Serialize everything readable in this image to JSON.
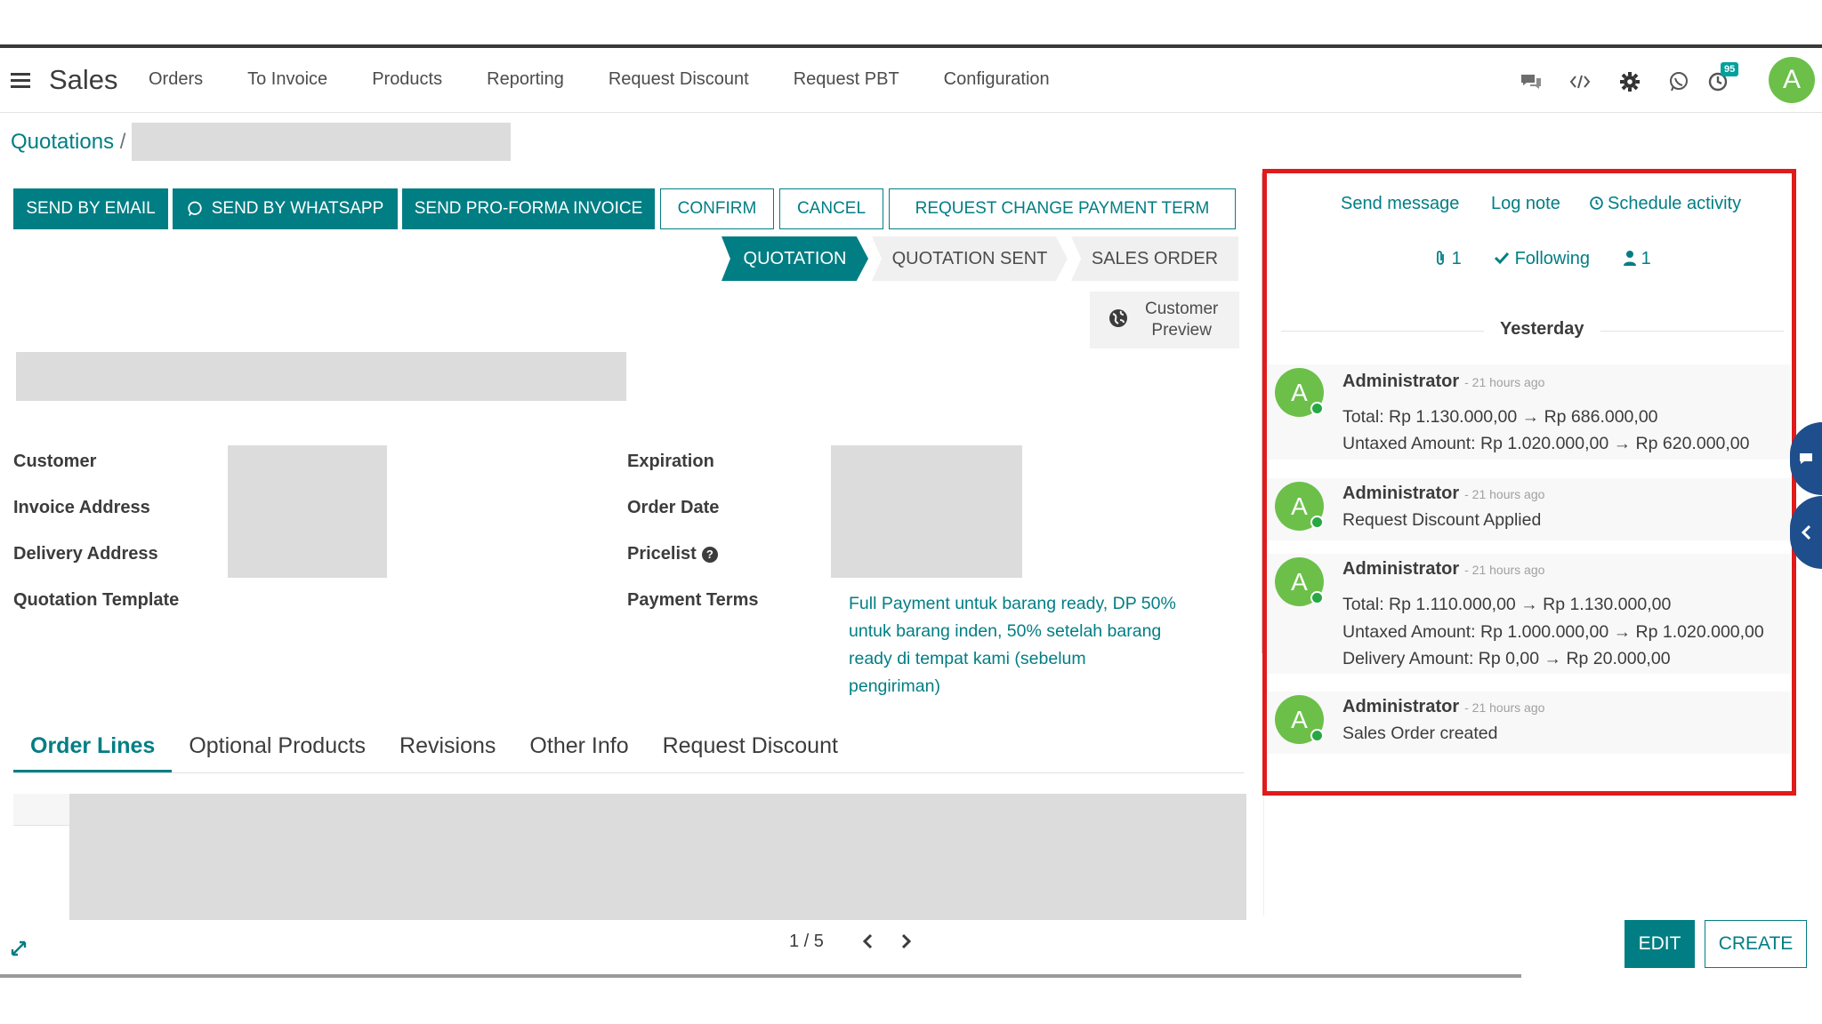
{
  "navbar": {
    "app_name": "Sales",
    "menu": [
      "Orders",
      "To Invoice",
      "Products",
      "Reporting",
      "Request Discount",
      "Request PBT",
      "Configuration"
    ],
    "activity_badge": "95",
    "avatar_letter": "A"
  },
  "breadcrumb": {
    "root": "Quotations",
    "separator": "/"
  },
  "actions": {
    "send_email": "SEND BY EMAIL",
    "send_whatsapp": "SEND BY WHATSAPP",
    "send_proforma": "SEND PRO-FORMA INVOICE",
    "confirm": "CONFIRM",
    "cancel": "CANCEL",
    "request_change": "REQUEST CHANGE PAYMENT TERM"
  },
  "statusbar": {
    "stages": [
      "QUOTATION",
      "QUOTATION SENT",
      "SALES ORDER"
    ],
    "active": "QUOTATION"
  },
  "customer_preview": {
    "line1": "Customer",
    "line2": "Preview"
  },
  "form": {
    "left_labels": [
      "Customer",
      "Invoice Address",
      "Delivery Address",
      "Quotation Template"
    ],
    "right_labels": [
      "Expiration",
      "Order Date",
      "Pricelist",
      "Payment Terms"
    ],
    "payment_terms_value": "Full Payment untuk barang ready, DP 50% untuk barang inden, 50% setelah barang ready di tempat kami (sebelum pengiriman)"
  },
  "tabs": [
    "Order Lines",
    "Optional Products",
    "Revisions",
    "Other Info",
    "Request Discount"
  ],
  "active_tab": "Order Lines",
  "pager": {
    "value": "1 / 5"
  },
  "footer": {
    "edit": "EDIT",
    "create": "CREATE"
  },
  "chatter": {
    "send_message": "Send message",
    "log_note": "Log note",
    "schedule_activity": "Schedule activity",
    "attachments": "1",
    "following": "Following",
    "followers": "1",
    "day_label": "Yesterday",
    "messages": [
      {
        "author": "Administrator",
        "time": "- 21 hours ago",
        "lines": [
          "Total: Rp 1.130.000,00 → Rp 686.000,00",
          "Untaxed Amount: Rp 1.020.000,00 → Rp 620.000,00"
        ]
      },
      {
        "author": "Administrator",
        "time": "- 21 hours ago",
        "lines": [
          "Request Discount Applied"
        ]
      },
      {
        "author": "Administrator",
        "time": "- 21 hours ago",
        "lines": [
          "Total: Rp 1.110.000,00 → Rp 1.130.000,00",
          "Untaxed Amount: Rp 1.000.000,00 → Rp 1.020.000,00",
          "Delivery Amount: Rp 0,00 → Rp 20.000,00"
        ]
      },
      {
        "author": "Administrator",
        "time": "- 21 hours ago",
        "lines": [
          "Sales Order created"
        ]
      }
    ]
  },
  "colors": {
    "primary": "#017e84",
    "highlight_box": "#e01b1b",
    "avatar": "#6cc04a"
  }
}
